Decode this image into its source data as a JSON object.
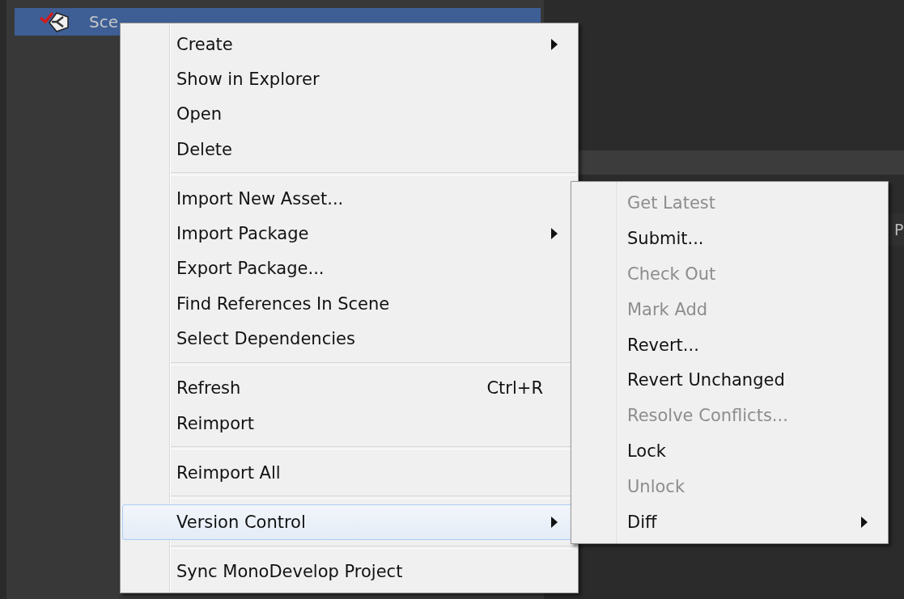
{
  "hierarchy": {
    "selected_row": {
      "label": "Sce",
      "selected": true
    }
  },
  "side_panel": {
    "tab_text": "P"
  },
  "context_menu": {
    "groups": [
      {
        "items": [
          {
            "label": "Create",
            "submenu": true,
            "selected": false
          },
          {
            "label": "Show in Explorer",
            "submenu": false,
            "selected": false
          },
          {
            "label": "Open",
            "submenu": false,
            "selected": false
          },
          {
            "label": "Delete",
            "submenu": false,
            "selected": false
          }
        ]
      },
      {
        "items": [
          {
            "label": "Import New Asset...",
            "submenu": false,
            "selected": false
          },
          {
            "label": "Import Package",
            "submenu": true,
            "selected": false
          },
          {
            "label": "Export Package...",
            "submenu": false,
            "selected": false
          },
          {
            "label": "Find References In Scene",
            "submenu": false,
            "selected": false
          },
          {
            "label": "Select Dependencies",
            "submenu": false,
            "selected": false
          }
        ]
      },
      {
        "items": [
          {
            "label": "Refresh",
            "shortcut": "Ctrl+R",
            "submenu": false,
            "selected": false
          },
          {
            "label": "Reimport",
            "submenu": false,
            "selected": false
          }
        ]
      },
      {
        "items": [
          {
            "label": "Reimport All",
            "submenu": false,
            "selected": false
          }
        ]
      },
      {
        "items": [
          {
            "label": "Version Control",
            "submenu": true,
            "selected": true
          }
        ]
      },
      {
        "items": [
          {
            "label": "Sync MonoDevelop Project",
            "submenu": false,
            "selected": false
          }
        ]
      }
    ]
  },
  "version_control_submenu": {
    "items": [
      {
        "label": "Get Latest",
        "disabled": true,
        "submenu": false
      },
      {
        "label": "Submit...",
        "disabled": false,
        "submenu": false
      },
      {
        "label": "Check Out",
        "disabled": true,
        "submenu": false
      },
      {
        "label": "Mark Add",
        "disabled": true,
        "submenu": false
      },
      {
        "label": "Revert...",
        "disabled": false,
        "submenu": false
      },
      {
        "label": "Revert Unchanged",
        "disabled": false,
        "submenu": false
      },
      {
        "label": "Resolve Conflicts...",
        "disabled": true,
        "submenu": false
      },
      {
        "label": "Lock",
        "disabled": false,
        "submenu": false
      },
      {
        "label": "Unlock",
        "disabled": true,
        "submenu": false
      },
      {
        "label": "Diff",
        "disabled": false,
        "submenu": true
      }
    ]
  }
}
